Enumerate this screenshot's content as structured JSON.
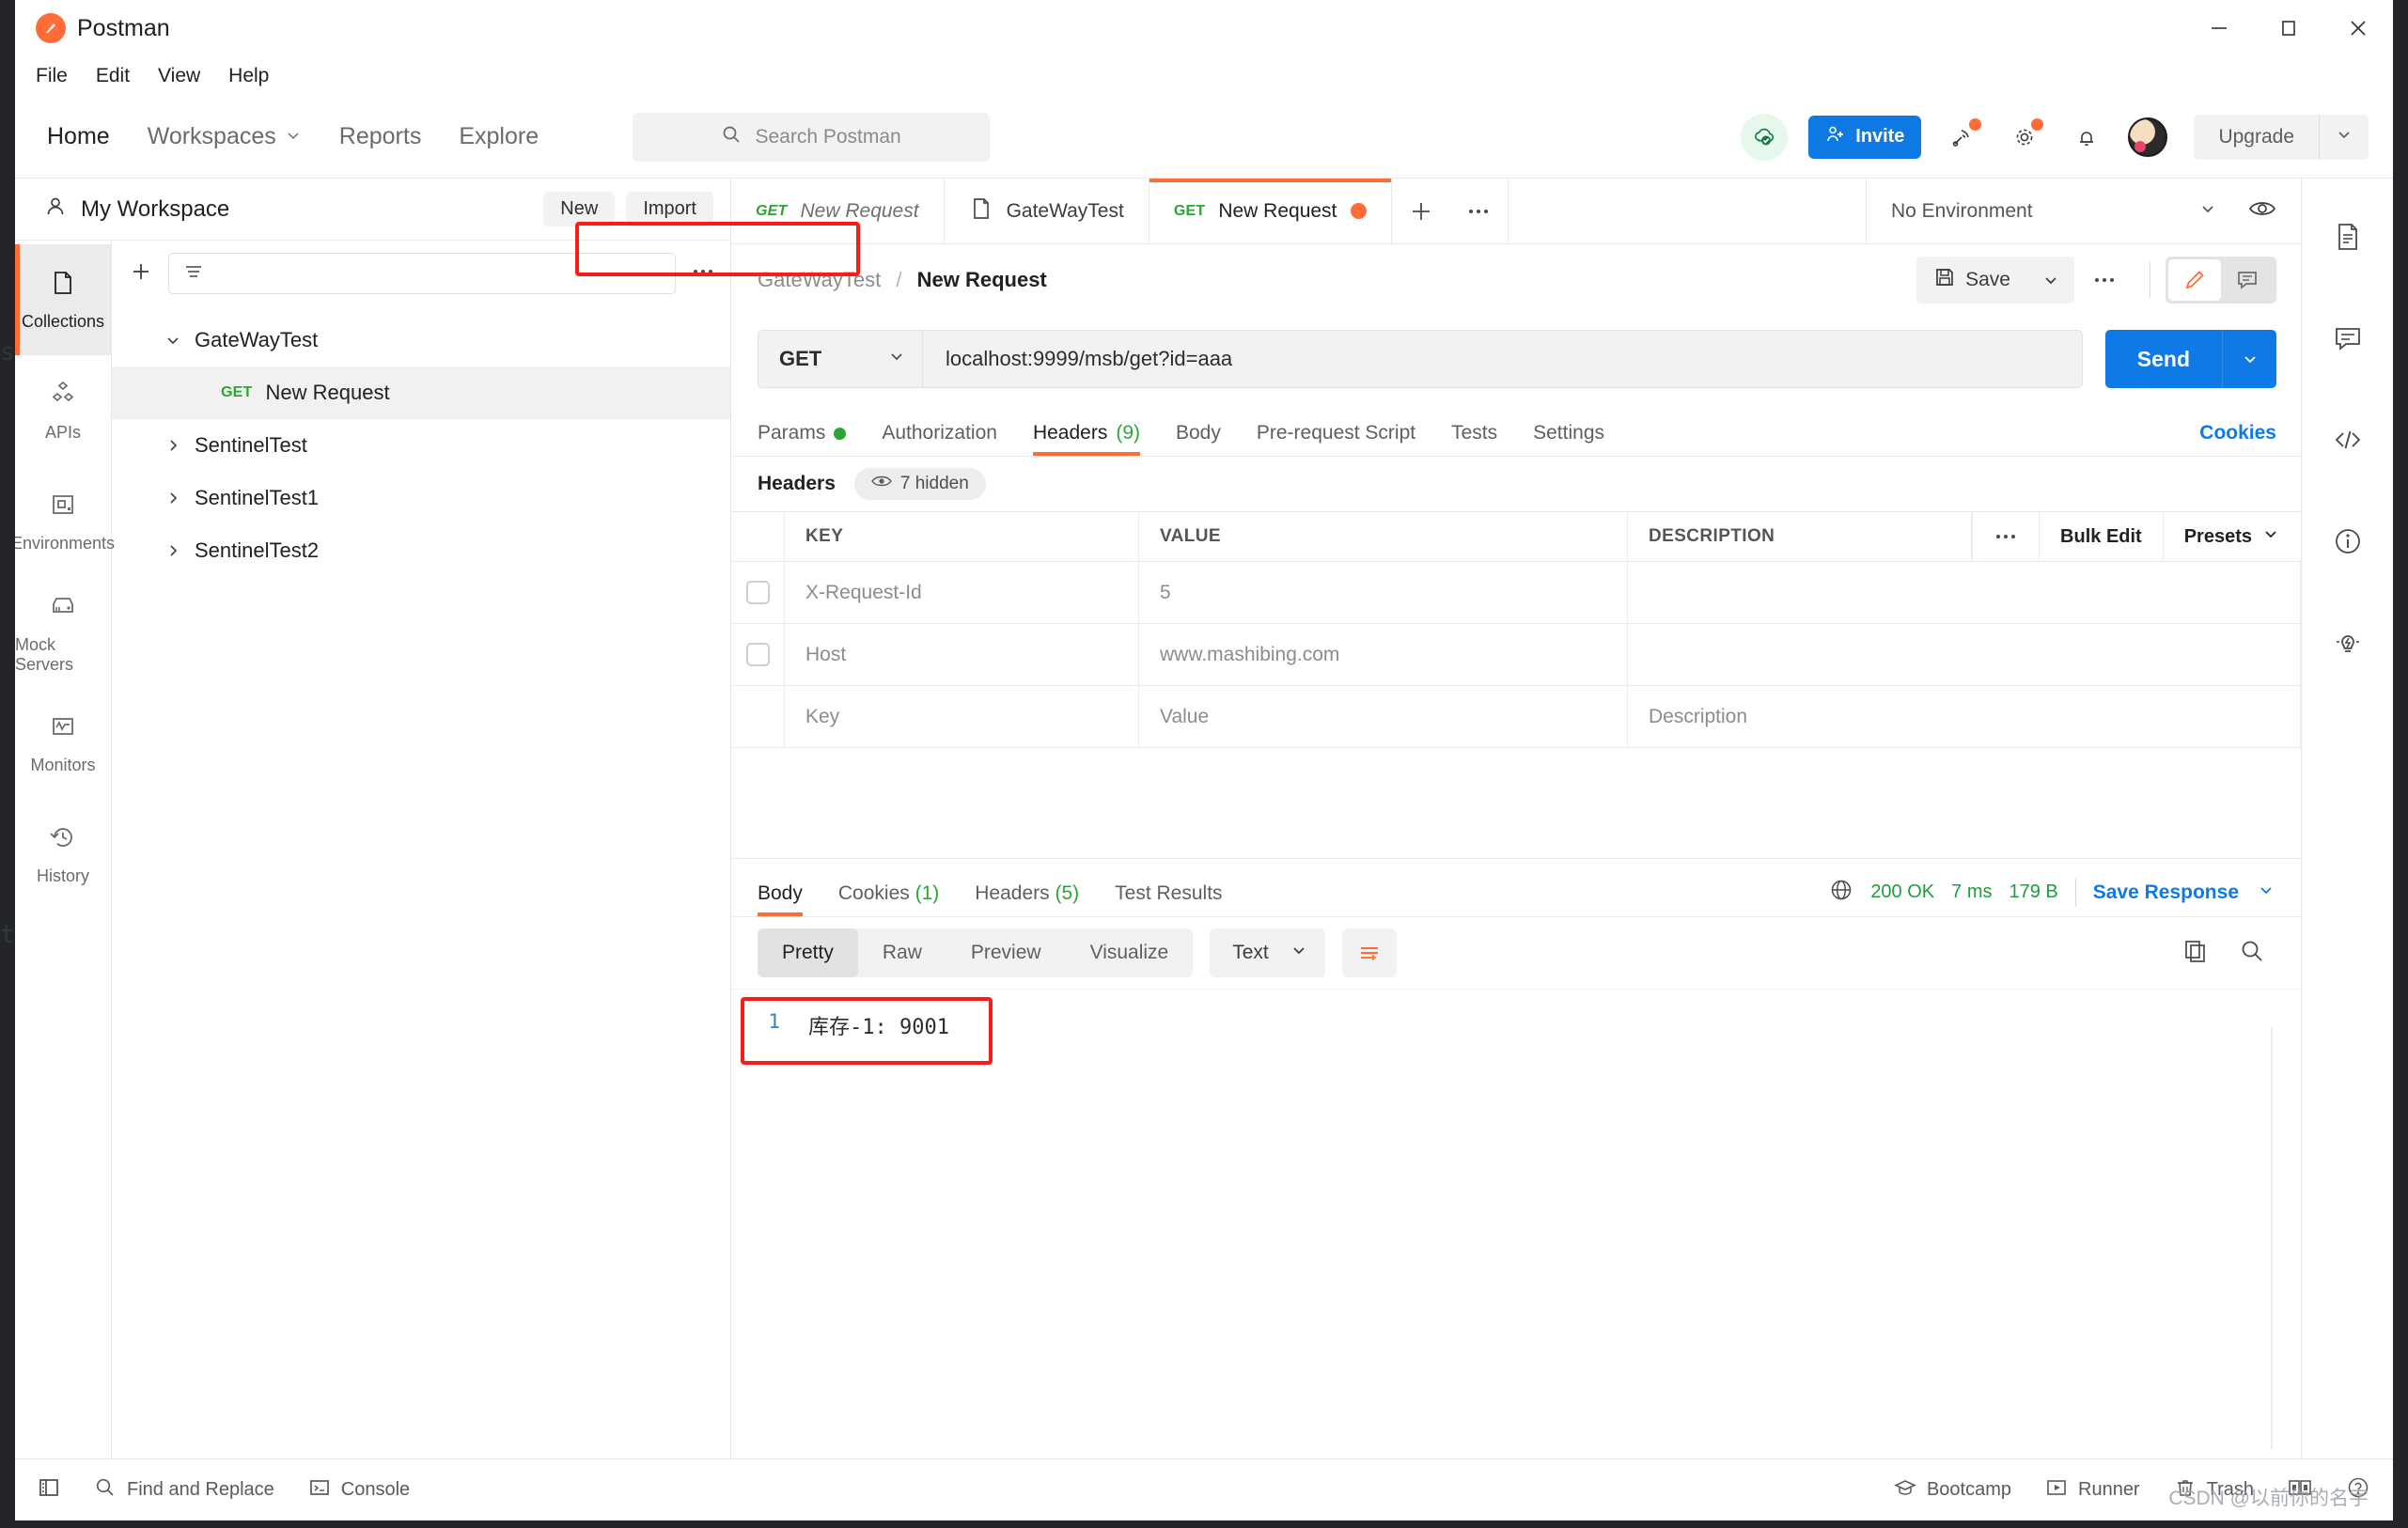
{
  "window": {
    "app_name": "Postman",
    "minimize": "–",
    "maximize": "▢",
    "close": "✕"
  },
  "menubar": {
    "items": [
      "File",
      "Edit",
      "View",
      "Help"
    ]
  },
  "navbar": {
    "items": [
      "Home",
      "Workspaces",
      "Reports",
      "Explore"
    ],
    "search_placeholder": "Search Postman",
    "invite_label": "Invite",
    "upgrade_label": "Upgrade",
    "icons": [
      "cloud-check-icon",
      "invite-icon",
      "satellite-icon",
      "gear-icon",
      "bell-icon",
      "avatar",
      "chevron-down-icon"
    ]
  },
  "sidebar": {
    "workspace_name": "My Workspace",
    "new_label": "New",
    "import_label": "Import",
    "rail": [
      {
        "label": "Collections",
        "icon": "collections-icon",
        "active": true
      },
      {
        "label": "APIs",
        "icon": "apis-icon",
        "active": false
      },
      {
        "label": "Environments",
        "icon": "environments-icon",
        "active": false
      },
      {
        "label": "Mock Servers",
        "icon": "mock-servers-icon",
        "active": false
      },
      {
        "label": "Monitors",
        "icon": "monitors-icon",
        "active": false
      },
      {
        "label": "History",
        "icon": "history-icon",
        "active": false
      }
    ],
    "tree": [
      {
        "label": "GateWayTest",
        "expanded": true,
        "depth": 0,
        "method": ""
      },
      {
        "label": "New Request",
        "expanded": false,
        "depth": 1,
        "method": "GET",
        "selected": true
      },
      {
        "label": "SentinelTest",
        "expanded": false,
        "depth": 0,
        "method": ""
      },
      {
        "label": "SentinelTest1",
        "expanded": false,
        "depth": 0,
        "method": ""
      },
      {
        "label": "SentinelTest2",
        "expanded": false,
        "depth": 0,
        "method": ""
      }
    ]
  },
  "tabstrip": {
    "tabs": [
      {
        "method": "GET",
        "title": "New Request",
        "active": false,
        "unsaved": false,
        "icon": ""
      },
      {
        "method": "",
        "title": "GateWayTest",
        "active": false,
        "unsaved": false,
        "icon": "document-icon"
      },
      {
        "method": "GET",
        "title": "New Request",
        "active": true,
        "unsaved": true,
        "icon": ""
      }
    ],
    "environment": "No Environment"
  },
  "request": {
    "breadcrumb_collection": "GateWayTest",
    "breadcrumb_separator": "/",
    "breadcrumb_name": "New Request",
    "save_label": "Save",
    "method": "GET",
    "url": "localhost:9999/msb/get?id=aaa",
    "send_label": "Send",
    "tabs": [
      {
        "label": "Params",
        "dot": true,
        "count": "",
        "active": false
      },
      {
        "label": "Authorization",
        "dot": false,
        "count": "",
        "active": false
      },
      {
        "label": "Headers",
        "dot": false,
        "count": "(9)",
        "active": true
      },
      {
        "label": "Body",
        "dot": false,
        "count": "",
        "active": false
      },
      {
        "label": "Pre-request Script",
        "dot": false,
        "count": "",
        "active": false
      },
      {
        "label": "Tests",
        "dot": false,
        "count": "",
        "active": false
      },
      {
        "label": "Settings",
        "dot": false,
        "count": "",
        "active": false
      }
    ],
    "cookies_link": "Cookies",
    "headers_label": "Headers",
    "hidden_pill": "7 hidden",
    "table": {
      "columns": [
        "KEY",
        "VALUE",
        "DESCRIPTION"
      ],
      "actions": [
        "Bulk Edit",
        "Presets"
      ],
      "rows": [
        {
          "checked": false,
          "key": "X-Request-Id",
          "value": "5",
          "description": ""
        },
        {
          "checked": false,
          "key": "Host",
          "value": "www.mashibing.com",
          "description": ""
        },
        {
          "checked": null,
          "key": "Key",
          "value": "Value",
          "description": "Description"
        }
      ]
    }
  },
  "response": {
    "tabs": [
      {
        "label": "Body",
        "count": "",
        "active": true
      },
      {
        "label": "Cookies",
        "count": "(1)",
        "active": false
      },
      {
        "label": "Headers",
        "count": "(5)",
        "active": false
      },
      {
        "label": "Test Results",
        "count": "",
        "active": false
      }
    ],
    "status": "200 OK",
    "time": "7 ms",
    "size": "179 B",
    "save_response_label": "Save Response",
    "view_pills": [
      "Pretty",
      "Raw",
      "Preview",
      "Visualize"
    ],
    "active_pill": "Pretty",
    "format": "Text",
    "body_lines": [
      {
        "no": "1",
        "text": "库存-1: 9001"
      }
    ]
  },
  "right_rail": {
    "icons": [
      "documentation-icon",
      "comment-icon",
      "code-icon",
      "info-icon",
      "lightbulb-icon"
    ]
  },
  "statusbar": {
    "left": [
      {
        "label": "",
        "icon": "sidebar-toggle-icon"
      },
      {
        "label": "Find and Replace",
        "icon": "search-icon"
      },
      {
        "label": "Console",
        "icon": "console-icon"
      }
    ],
    "right": [
      {
        "label": "Bootcamp",
        "icon": "bootcamp-icon"
      },
      {
        "label": "Runner",
        "icon": "runner-icon"
      },
      {
        "label": "Trash",
        "icon": "trash-icon"
      },
      {
        "label": "",
        "icon": "layout-icon"
      },
      {
        "label": "",
        "icon": "help-icon"
      }
    ]
  },
  "watermark": "CSDN @以前你的名字",
  "colors": {
    "accent": "#ff6c37",
    "primary": "#0f7ae5",
    "success": "#29a634",
    "highlight": "#ff1a1a"
  }
}
